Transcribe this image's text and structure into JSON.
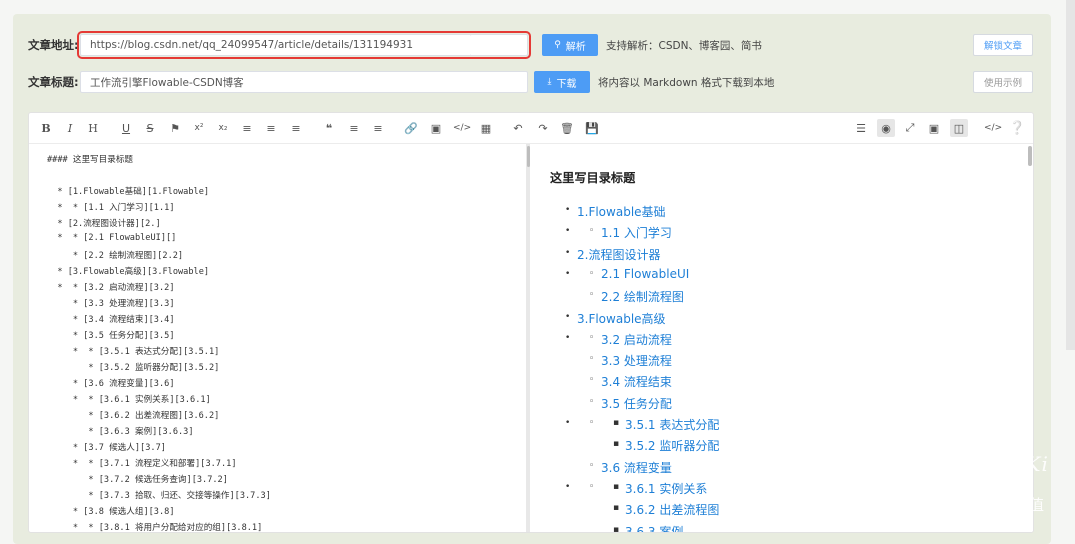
{
  "form": {
    "url_label": "文章地址:",
    "url_value": "https://blog.csdn.net/qq_24099547/article/details/131194931",
    "parse_button": "解析",
    "parse_hint": "支持解析：CSDN、博客园、简书",
    "title_label": "文章标题:",
    "title_value": "工作流引擎Flowable-CSDN博客",
    "download_button": "下载",
    "download_hint": "将内容以 Markdown 格式下载到本地",
    "unlock_button": "解锁文章",
    "example_button": "使用示例"
  },
  "toolbar": {
    "left_icons": [
      "bold-icon",
      "italic-icon",
      "heading-icon",
      "underline-icon",
      "strikethrough-icon",
      "bookmark-icon",
      "superscript-icon",
      "subscript-icon",
      "align-left-icon",
      "align-center-icon",
      "align-right-icon",
      "quote-icon",
      "ordered-list-icon",
      "unordered-list-icon",
      "link-icon",
      "image-icon",
      "code-icon",
      "table-icon",
      "undo-icon",
      "redo-icon",
      "trash-icon",
      "save-icon"
    ],
    "right_icons": [
      "menu-icon",
      "preview-toggle-icon",
      "fullscreen-icon",
      "window-icon",
      "split-view-icon",
      "html-code-icon",
      "help-icon"
    ]
  },
  "markdown_lines": [
    "#### 这里写目录标题",
    "",
    "  * [1.Flowable基础][1.Flowable]",
    "  *  * [1.1 入门学习][1.1]",
    "  * [2.流程图设计器][2.]",
    "  *  * [2.1 FlowableUI][]",
    "     * [2.2 绘制流程图][2.2]",
    "  * [3.Flowable高级][3.Flowable]",
    "  *  * [3.2 启动流程][3.2]",
    "     * [3.3 处理流程][3.3]",
    "     * [3.4 流程结束][3.4]",
    "     * [3.5 任务分配][3.5]",
    "     *  * [3.5.1 表达式分配][3.5.1]",
    "        * [3.5.2 监听器分配][3.5.2]",
    "     * [3.6 流程变量][3.6]",
    "     *  * [3.6.1 实例关系][3.6.1]",
    "        * [3.6.2 出差流程图][3.6.2]",
    "        * [3.6.3 案例][3.6.3]",
    "     * [3.7 候选人][3.7]",
    "     *  * [3.7.1 流程定义和部署][3.7.1]",
    "        * [3.7.2 候选任务查询][3.7.2]",
    "        * [3.7.3 拾取、归还、交接等操作][3.7.3]",
    "     * [3.8 候选人组][3.8]",
    "     *  * [3.8.1 将用户分配给对应的组][3.8.1]"
  ],
  "preview": {
    "heading": "这里写目录标题",
    "items": [
      {
        "text": "1.Flowable基础",
        "level": 1,
        "extra": false
      },
      {
        "text": "1.1 入门学习",
        "level": 2,
        "extra": true
      },
      {
        "text": "2.流程图设计器",
        "level": 1,
        "extra": false
      },
      {
        "text": "2.1 FlowableUI",
        "level": 2,
        "extra": true
      },
      {
        "text": "2.2 绘制流程图",
        "level": 2,
        "extra": false
      },
      {
        "text": "3.Flowable高级",
        "level": 1,
        "extra": false
      },
      {
        "text": "3.2 启动流程",
        "level": 2,
        "extra": true
      },
      {
        "text": "3.3 处理流程",
        "level": 2,
        "extra": false
      },
      {
        "text": "3.4 流程结束",
        "level": 2,
        "extra": false
      },
      {
        "text": "3.5 任务分配",
        "level": 2,
        "extra": false
      },
      {
        "text": "3.5.1 表达式分配",
        "level": 3,
        "extra": true
      },
      {
        "text": "3.5.2 监听器分配",
        "level": 3,
        "extra": false
      },
      {
        "text": "3.6 流程变量",
        "level": 2,
        "extra": false
      },
      {
        "text": "3.6.1 实例关系",
        "level": 3,
        "extra": true
      },
      {
        "text": "3.6.2 出差流程图",
        "level": 3,
        "extra": false
      },
      {
        "text": "3.6.3 案例",
        "level": 3,
        "extra": false
      }
    ]
  },
  "watermark": {
    "brand": "JiLu.WiKi",
    "slogan": "让每条记录都有价值"
  },
  "colors": {
    "accent": "#4d9cf5",
    "link": "#1e7fd6",
    "highlight_border": "#e53935",
    "panel_bg": "#e8ecdf"
  }
}
